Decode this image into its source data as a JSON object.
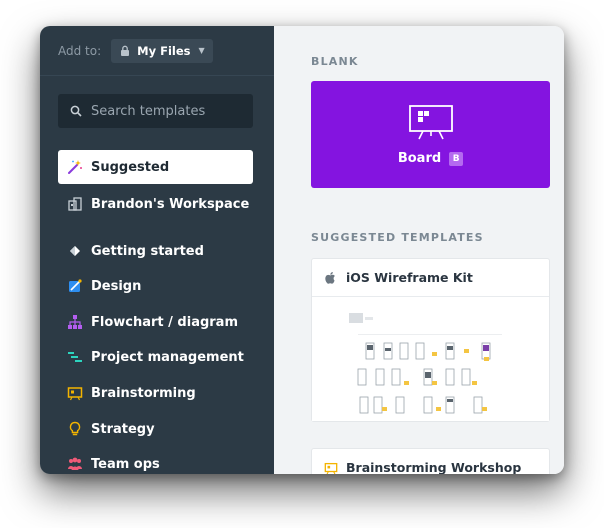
{
  "header": {
    "add_to_label": "Add to:",
    "location": "My Files"
  },
  "search": {
    "placeholder": "Search templates"
  },
  "sidebar": {
    "items": [
      {
        "label": "Suggested",
        "icon": "magic-wand-icon",
        "active": true
      },
      {
        "label": "Brandon's Workspace",
        "icon": "workspace-icon",
        "active": false
      },
      {
        "label": "Getting started",
        "icon": "diamond-icon",
        "active": false
      },
      {
        "label": "Design",
        "icon": "design-icon",
        "active": false
      },
      {
        "label": "Flowchart / diagram",
        "icon": "flowchart-icon",
        "active": false
      },
      {
        "label": "Project management",
        "icon": "project-icon",
        "active": false
      },
      {
        "label": "Brainstorming",
        "icon": "brainstorm-icon",
        "active": false
      },
      {
        "label": "Strategy",
        "icon": "lightbulb-icon",
        "active": false
      },
      {
        "label": "Team ops",
        "icon": "team-icon",
        "active": false
      }
    ]
  },
  "main": {
    "blank_label": "BLANK",
    "board": {
      "label": "Board",
      "badge": "B"
    },
    "suggested_label": "SUGGESTED TEMPLATES",
    "templates": [
      {
        "title": "iOS Wireframe Kit",
        "icon": "apple-icon"
      },
      {
        "title": "Brainstorming Workshop",
        "icon": "brainstorm-icon"
      }
    ]
  },
  "colors": {
    "sidebar_bg": "#2c3a45",
    "board_purple": "#8414e0",
    "main_bg": "#f1f3f5"
  }
}
